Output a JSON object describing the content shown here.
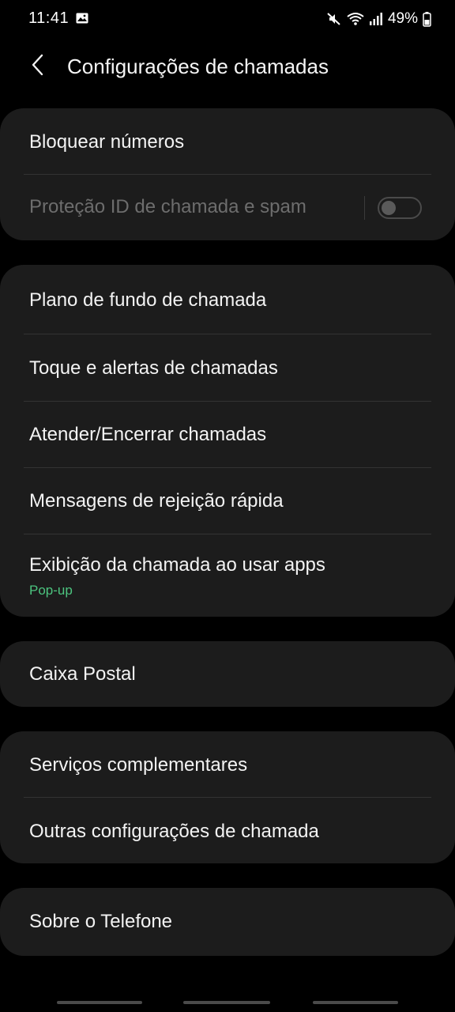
{
  "status_bar": {
    "time": "11:41",
    "battery": "49%",
    "icons": [
      "gallery-icon",
      "mute-icon",
      "wifi-icon",
      "signal-icon",
      "battery-icon"
    ]
  },
  "header": {
    "back_icon": "chevron-left-icon",
    "title": "Configurações de chamadas"
  },
  "groups": [
    {
      "items": [
        {
          "label": "Bloquear números"
        },
        {
          "label": "Proteção ID de chamada e spam",
          "toggle": false,
          "disabled": true
        }
      ]
    },
    {
      "items": [
        {
          "label": "Plano de fundo de chamada"
        },
        {
          "label": "Toque e alertas de chamadas"
        },
        {
          "label": "Atender/Encerrar chamadas"
        },
        {
          "label": "Mensagens de rejeição rápida"
        },
        {
          "label": "Exibição da chamada ao usar apps",
          "sub": "Pop-up"
        }
      ]
    },
    {
      "items": [
        {
          "label": "Caixa Postal"
        }
      ]
    },
    {
      "items": [
        {
          "label": "Serviços complementares"
        },
        {
          "label": "Outras configurações de chamada"
        }
      ]
    },
    {
      "items": [
        {
          "label": "Sobre o Telefone"
        }
      ]
    }
  ],
  "colors": {
    "background": "#000000",
    "card": "#1c1c1c",
    "accent": "#4cc47f",
    "text": "#f3f3f3",
    "disabled_text": "#6d6d6d"
  }
}
